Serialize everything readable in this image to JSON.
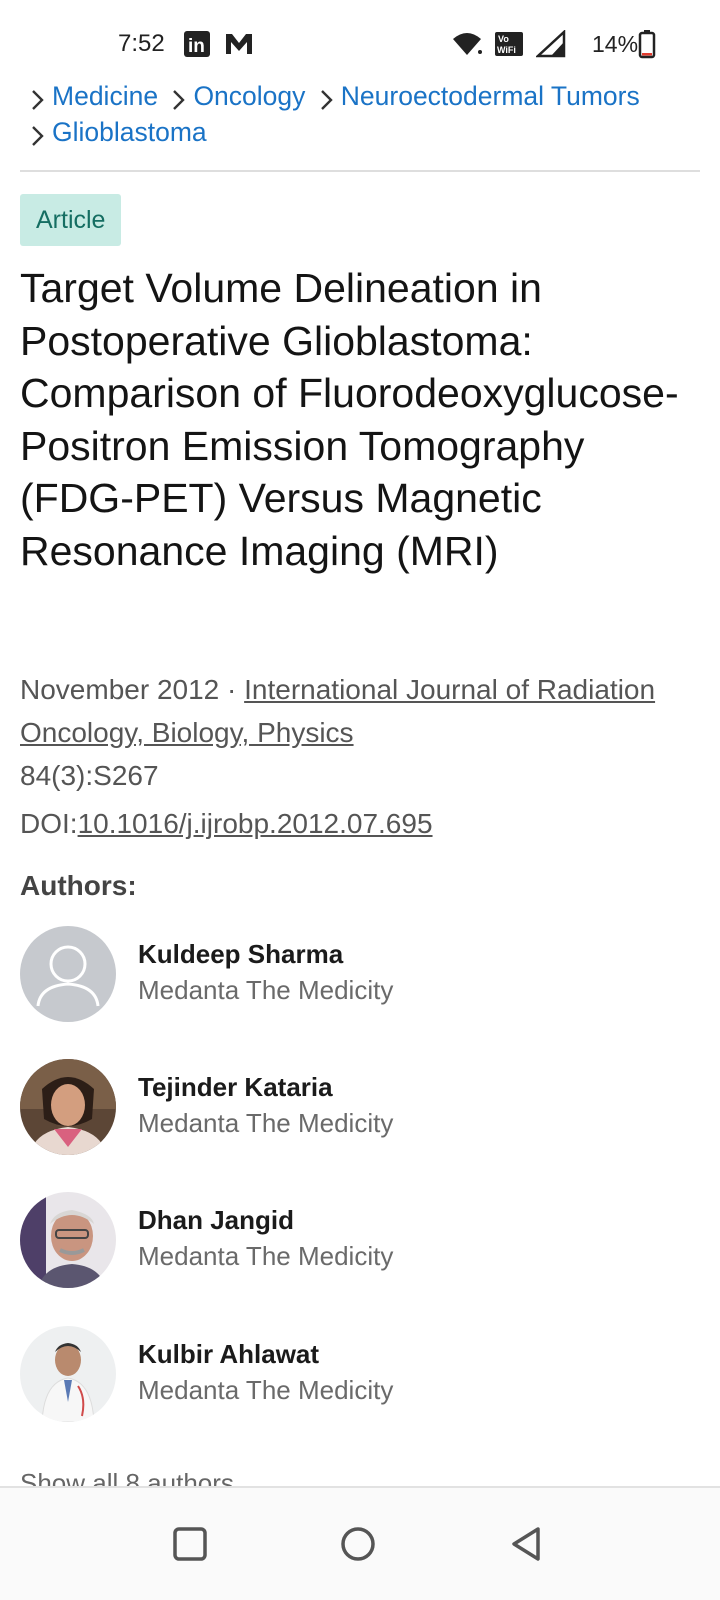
{
  "status_bar": {
    "time": "7:52",
    "battery": "14%",
    "icons": [
      "linkedin-icon",
      "m-app-icon",
      "wifi-icon",
      "volte-wifi-icon",
      "signal-icon",
      "battery-icon"
    ]
  },
  "breadcrumb": {
    "items": [
      "Medicine",
      "Oncology",
      "Neuroectodermal Tumors",
      "Glioblastoma"
    ],
    "color": "#1a73c6"
  },
  "article": {
    "badge": "Article",
    "title": "Target Volume Delineation in Postoperative Glioblastoma: Comparison of Fluorodeoxyglucose-Positron Emission Tomography (FDG-PET) Versus Magnetic Resonance Imaging (MRI)",
    "date": "November 2012",
    "separator": " · ",
    "journal": "International Journal of Radiation Oncology, Biology, Physics",
    "volume": "84(3):S267",
    "doi_label": "DOI:",
    "doi": "10.1016/j.ijrobp.2012.07.695"
  },
  "authors": {
    "heading": "Authors:",
    "list": [
      {
        "name": "Kuldeep Sharma",
        "affiliation": "Medanta The Medicity",
        "avatar": "placeholder"
      },
      {
        "name": "Tejinder Kataria",
        "affiliation": "Medanta The Medicity",
        "avatar": "photo"
      },
      {
        "name": "Dhan Jangid",
        "affiliation": "Medanta The Medicity",
        "avatar": "photo"
      },
      {
        "name": "Kulbir Ahlawat",
        "affiliation": "Medanta The Medicity",
        "avatar": "photo"
      }
    ],
    "show_all": "Show all 8 authors"
  },
  "nav_bar": {
    "buttons": [
      "recents-button",
      "home-button",
      "back-button"
    ]
  },
  "colors": {
    "badge_bg": "#c8ebe4",
    "badge_text": "#156e62",
    "link": "#1a73c6"
  }
}
